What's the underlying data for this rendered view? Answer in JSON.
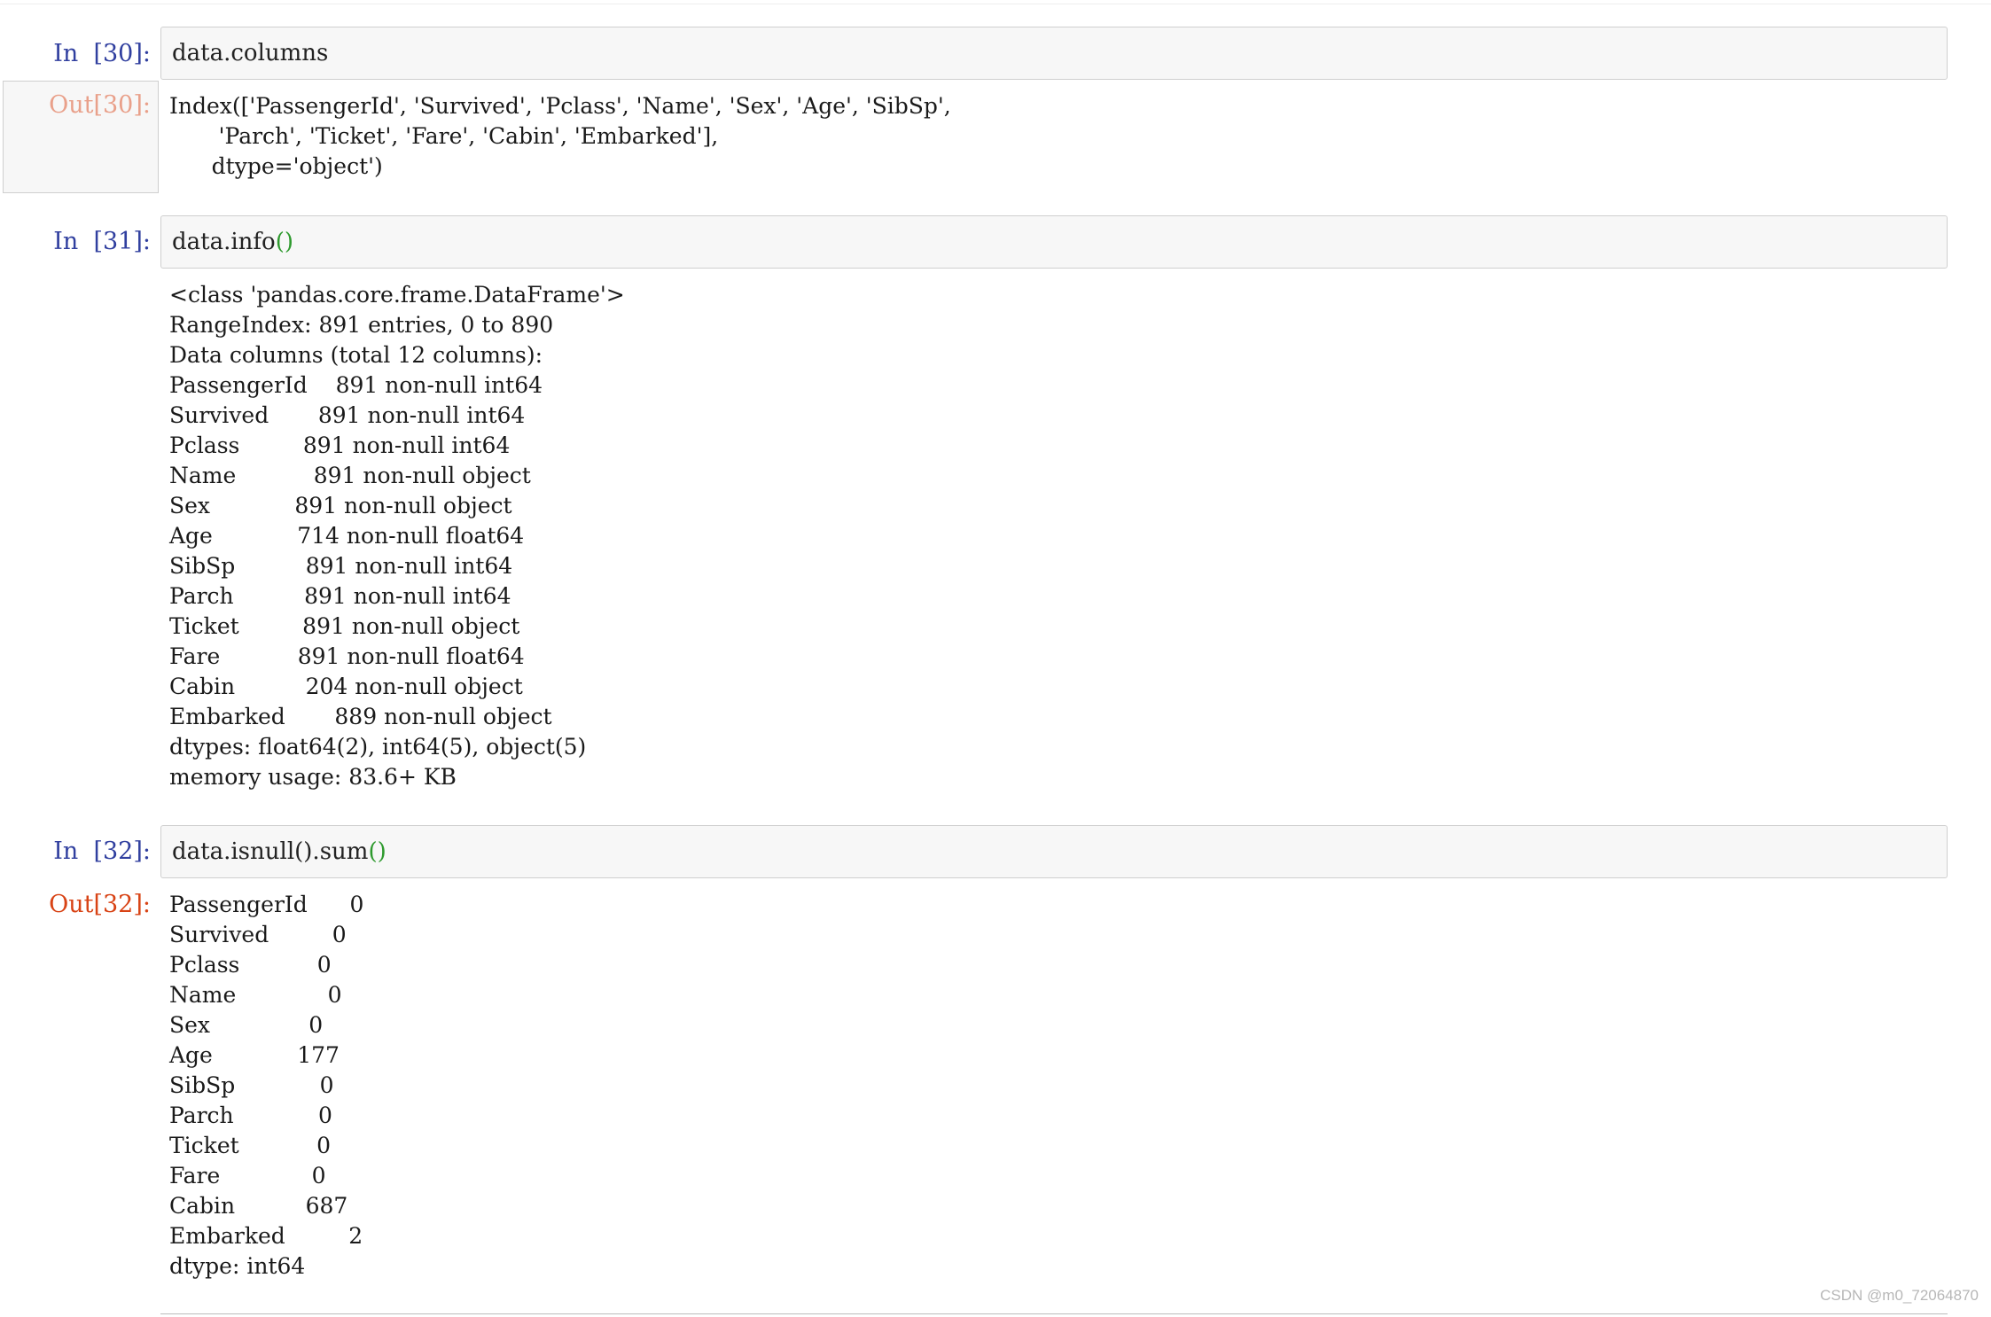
{
  "cells": [
    {
      "in_prompt": "In  [30]:",
      "code": "data.columns",
      "out_prompt": "Out[30]:",
      "output": "Index(['PassengerId', 'Survived', 'Pclass', 'Name', 'Sex', 'Age', 'SibSp',\n       'Parch', 'Ticket', 'Fare', 'Cabin', 'Embarked'],\n      dtype='object')"
    },
    {
      "in_prompt": "In  [31]:",
      "code": "data.info",
      "code_parens": "()",
      "output": "<class 'pandas.core.frame.DataFrame'>\nRangeIndex: 891 entries, 0 to 890\nData columns (total 12 columns):\nPassengerId    891 non-null int64\nSurvived       891 non-null int64\nPclass         891 non-null int64\nName           891 non-null object\nSex            891 non-null object\nAge            714 non-null float64\nSibSp          891 non-null int64\nParch          891 non-null int64\nTicket         891 non-null object\nFare           891 non-null float64\nCabin          204 non-null object\nEmbarked       889 non-null object\ndtypes: float64(2), int64(5), object(5)\nmemory usage: 83.6+ KB"
    },
    {
      "in_prompt": "In  [32]:",
      "code": "data.isnull().sum",
      "code_parens": "()",
      "out_prompt": "Out[32]:",
      "output": "PassengerId      0\nSurvived         0\nPclass           0\nName             0\nSex              0\nAge            177\nSibSp            0\nParch            0\nTicket           0\nFare             0\nCabin          687\nEmbarked         2\ndtype: int64"
    }
  ],
  "watermark": "CSDN @m0_72064870",
  "colors": {
    "in_prompt": "#303f9f",
    "out_prompt": "#d84315",
    "input_background": "#f7f7f7",
    "parens": "#2e9a2e"
  }
}
